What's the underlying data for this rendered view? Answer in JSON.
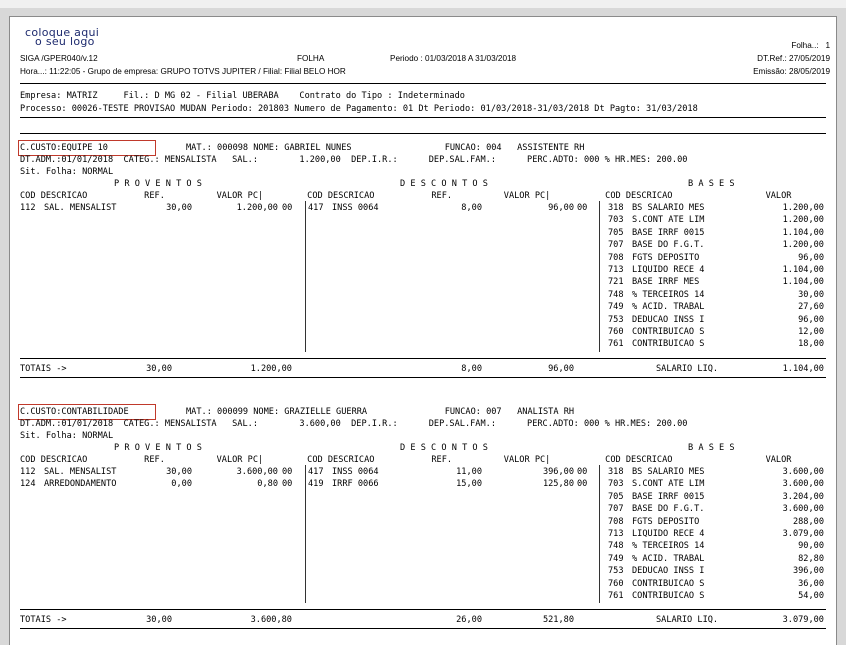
{
  "logo": {
    "line1": "coloque aqui",
    "line2": "o seu logo"
  },
  "header": {
    "sistema": "SIGA /GPER040/v.12",
    "folha": "FOLHA",
    "periodo": "Periodo : 01/03/2018 A 31/03/2018",
    "folha_num": "Folha..:   1",
    "dtref": "DT.Ref.: 27/05/2019",
    "hora": "Hora...: 11:22:05 - Grupo de empresa: GRUPO TOTVS JUPITER / Filial: Filial BELO HOR",
    "emissao": "Emissão: 28/05/2019"
  },
  "empresa_line": "Empresa: MATRIZ     Fil.: D MG 02 - Filial UBERABA    Contrato do Tipo : Indeterminado",
  "processo_line": "Processo: 00026-TESTE PROVISAO MUDAN Periodo: 201803 Numero de Pagamento: 01 Dt Periodo: 01/03/2018-31/03/2018 Dt Pagto: 31/03/2018",
  "section_titles": {
    "proventos": "P R O V E N T O S",
    "descontos": "D E S C O N T O S",
    "bases": "B A S E S"
  },
  "col_headers": {
    "prov": "COD DESCRICAO           REF.          VALOR PC|",
    "desc": " COD DESCRICAO           REF.          VALOR PC|",
    "bases": " COD DESCRICAO                  VALOR"
  },
  "employees": [
    {
      "ccusto": "C.CUSTO:EQUIPE 10",
      "line1": "MAT.: 000098 NOME: GABRIEL NUNES                  FUNCAO: 004   ASSISTENTE RH",
      "line2": "DT.ADM.:01/01/2018  CATEG.: MENSALISTA   SAL.:        1.200,00  DEP.I.R.:      DEP.SAL.FAM.:      PERC.ADTO: 000 % HR.MES: 200.00",
      "line3": "Sit. Folha: NORMAL",
      "proventos": [
        {
          "cod": "112",
          "desc": "SAL. MENSALIST",
          "ref": "30,00",
          "valor": "1.200,00",
          "pc": "00"
        }
      ],
      "descontos": [
        {
          "cod": "417",
          "desc": "INSS 0064",
          "ref": "8,00",
          "valor": "96,00",
          "pc": "00"
        }
      ],
      "bases": [
        {
          "cod": "318",
          "desc": "BS SALARIO MES",
          "valor": "1.200,00"
        },
        {
          "cod": "703",
          "desc": "S.CONT ATE LIM",
          "valor": "1.200,00"
        },
        {
          "cod": "705",
          "desc": "BASE IRRF 0015",
          "valor": "1.104,00"
        },
        {
          "cod": "707",
          "desc": "BASE DO F.G.T.",
          "valor": "1.200,00"
        },
        {
          "cod": "708",
          "desc": "FGTS DEPOSITO",
          "valor": "96,00"
        },
        {
          "cod": "713",
          "desc": "LIQUIDO RECE 4",
          "valor": "1.104,00"
        },
        {
          "cod": "721",
          "desc": "BASE IRRF MES",
          "valor": "1.104,00"
        },
        {
          "cod": "748",
          "desc": "% TERCEIROS 14",
          "valor": "30,00"
        },
        {
          "cod": "749",
          "desc": "% ACID. TRABAL",
          "valor": "27,60"
        },
        {
          "cod": "753",
          "desc": "DEDUCAO INSS I",
          "valor": "96,00"
        },
        {
          "cod": "760",
          "desc": "CONTRIBUICAO S",
          "valor": "12,00"
        },
        {
          "cod": "761",
          "desc": "CONTRIBUICAO S",
          "valor": "18,00"
        }
      ],
      "totais": {
        "label": "TOTAIS ->",
        "prov_ref": "30,00",
        "prov_val": "1.200,00",
        "desc_ref": "8,00",
        "desc_val": "96,00",
        "liq_label": "SALARIO LIQ.",
        "liq_val": "1.104,00"
      }
    },
    {
      "ccusto": "C.CUSTO:CONTABILIDADE",
      "line1": "MAT.: 000099 NOME: GRAZIELLE GUERRA               FUNCAO: 007   ANALISTA RH",
      "line2": "DT.ADM.:01/01/2018  CATEG.: MENSALISTA   SAL.:        3.600,00  DEP.I.R.:      DEP.SAL.FAM.:      PERC.ADTO: 000 % HR.MES: 200.00",
      "line3": "Sit. Folha: NORMAL",
      "proventos": [
        {
          "cod": "112",
          "desc": "SAL. MENSALIST",
          "ref": "30,00",
          "valor": "3.600,00",
          "pc": "00"
        },
        {
          "cod": "124",
          "desc": "ARREDONDAMENTO",
          "ref": "0,00",
          "valor": "0,80",
          "pc": "00"
        }
      ],
      "descontos": [
        {
          "cod": "417",
          "desc": "INSS 0064",
          "ref": "11,00",
          "valor": "396,00",
          "pc": "00"
        },
        {
          "cod": "419",
          "desc": "IRRF 0066",
          "ref": "15,00",
          "valor": "125,80",
          "pc": "00"
        }
      ],
      "bases": [
        {
          "cod": "318",
          "desc": "BS SALARIO MES",
          "valor": "3.600,00"
        },
        {
          "cod": "703",
          "desc": "S.CONT ATE LIM",
          "valor": "3.600,00"
        },
        {
          "cod": "705",
          "desc": "BASE IRRF 0015",
          "valor": "3.204,00"
        },
        {
          "cod": "707",
          "desc": "BASE DO F.G.T.",
          "valor": "3.600,00"
        },
        {
          "cod": "708",
          "desc": "FGTS DEPOSITO",
          "valor": "288,00"
        },
        {
          "cod": "713",
          "desc": "LIQUIDO RECE 4",
          "valor": "3.079,00"
        },
        {
          "cod": "748",
          "desc": "% TERCEIROS 14",
          "valor": "90,00"
        },
        {
          "cod": "749",
          "desc": "% ACID. TRABAL",
          "valor": "82,80"
        },
        {
          "cod": "753",
          "desc": "DEDUCAO INSS I",
          "valor": "396,00"
        },
        {
          "cod": "760",
          "desc": "CONTRIBUICAO S",
          "valor": "36,00"
        },
        {
          "cod": "761",
          "desc": "CONTRIBUICAO S",
          "valor": "54,00"
        }
      ],
      "totais": {
        "label": "TOTAIS ->",
        "prov_ref": "30,00",
        "prov_val": "3.600,80",
        "desc_ref": "26,00",
        "desc_val": "521,80",
        "liq_label": "SALARIO LIQ.",
        "liq_val": "3.079,00"
      }
    }
  ]
}
